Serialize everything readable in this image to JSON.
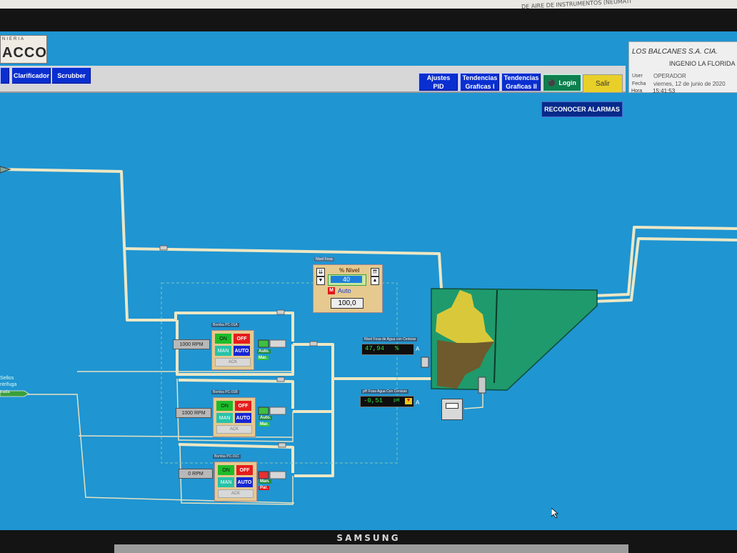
{
  "paper": {
    "text": "DE AIRE DE INSTRUMENTOS (NEUMATI"
  },
  "monitor": {
    "brand": "SAMSUNG"
  },
  "logo": {
    "top": "NIERIA",
    "main": "ACCO"
  },
  "toolbar": {
    "clarificador": "Clarificador",
    "scrubber": "Scrubber",
    "ajustes_l1": "Ajustes",
    "ajustes_l2": "PID",
    "tend1_l1": "Tendencias",
    "tend1_l2": "Graficas I",
    "tend2_l1": "Tendencias",
    "tend2_l2": "Graficas II",
    "login": "Login",
    "salir": "Salir"
  },
  "info": {
    "company": "LOS BALCANES S.A. CIA.",
    "ingenio": "INGENIO LA FLORIDA",
    "user_label": "User",
    "user": "OPERADOR",
    "fecha_label": "Fecha",
    "fecha": "viernes, 12 de junio de 2020",
    "hora_label": "Hora",
    "hora": "15:41:53"
  },
  "reconocer": "RECONOCER ALARMAS",
  "nivel": {
    "title": "Nivel Fosa",
    "label": "% Nivel",
    "setpoint": "40",
    "mode_m": "M",
    "mode": "Auto",
    "value": "100,0"
  },
  "pumps": [
    {
      "title": "Bomba PC-01A",
      "rpm": "1000 RPM",
      "on": "ON",
      "off": "OFF",
      "man": "MAN",
      "auto": "AUTO",
      "foot": "ACK",
      "state1": "Auto.",
      "state2": "Mar."
    },
    {
      "title": "Bomba PC-01B",
      "rpm": "1000 RPM",
      "on": "ON",
      "off": "OFF",
      "man": "MAN",
      "auto": "AUTO",
      "foot": "ACK",
      "state1": "Auto.",
      "state2": "Mar."
    },
    {
      "title": "Bomba PC-01C",
      "rpm": "0 RPM",
      "on": "ON",
      "off": "OFF",
      "man": "MAN",
      "auto": "AUTO",
      "foot": "ACK",
      "state1": "Man.",
      "state2": "Par."
    }
  ],
  "level_readout": {
    "label": "Nivel Fosa de Agua con Cenizas",
    "value": "47,94",
    "unit": "%",
    "mode": "A"
  },
  "ph_readout": {
    "label": "pH Fosa Agua Con Cenizas",
    "value": "-0,51",
    "unit": "pH",
    "mode": "A"
  },
  "left_labels": {
    "line1": "Sellos",
    "line2": "ntrifuga",
    "tag": "trada"
  },
  "colors": {
    "screen": "#1f95d2",
    "pipe": "#ece7c4",
    "tank": "#1f9a6c",
    "ash_yellow": "#d9c93a",
    "ash_brown": "#6e5a2c"
  }
}
